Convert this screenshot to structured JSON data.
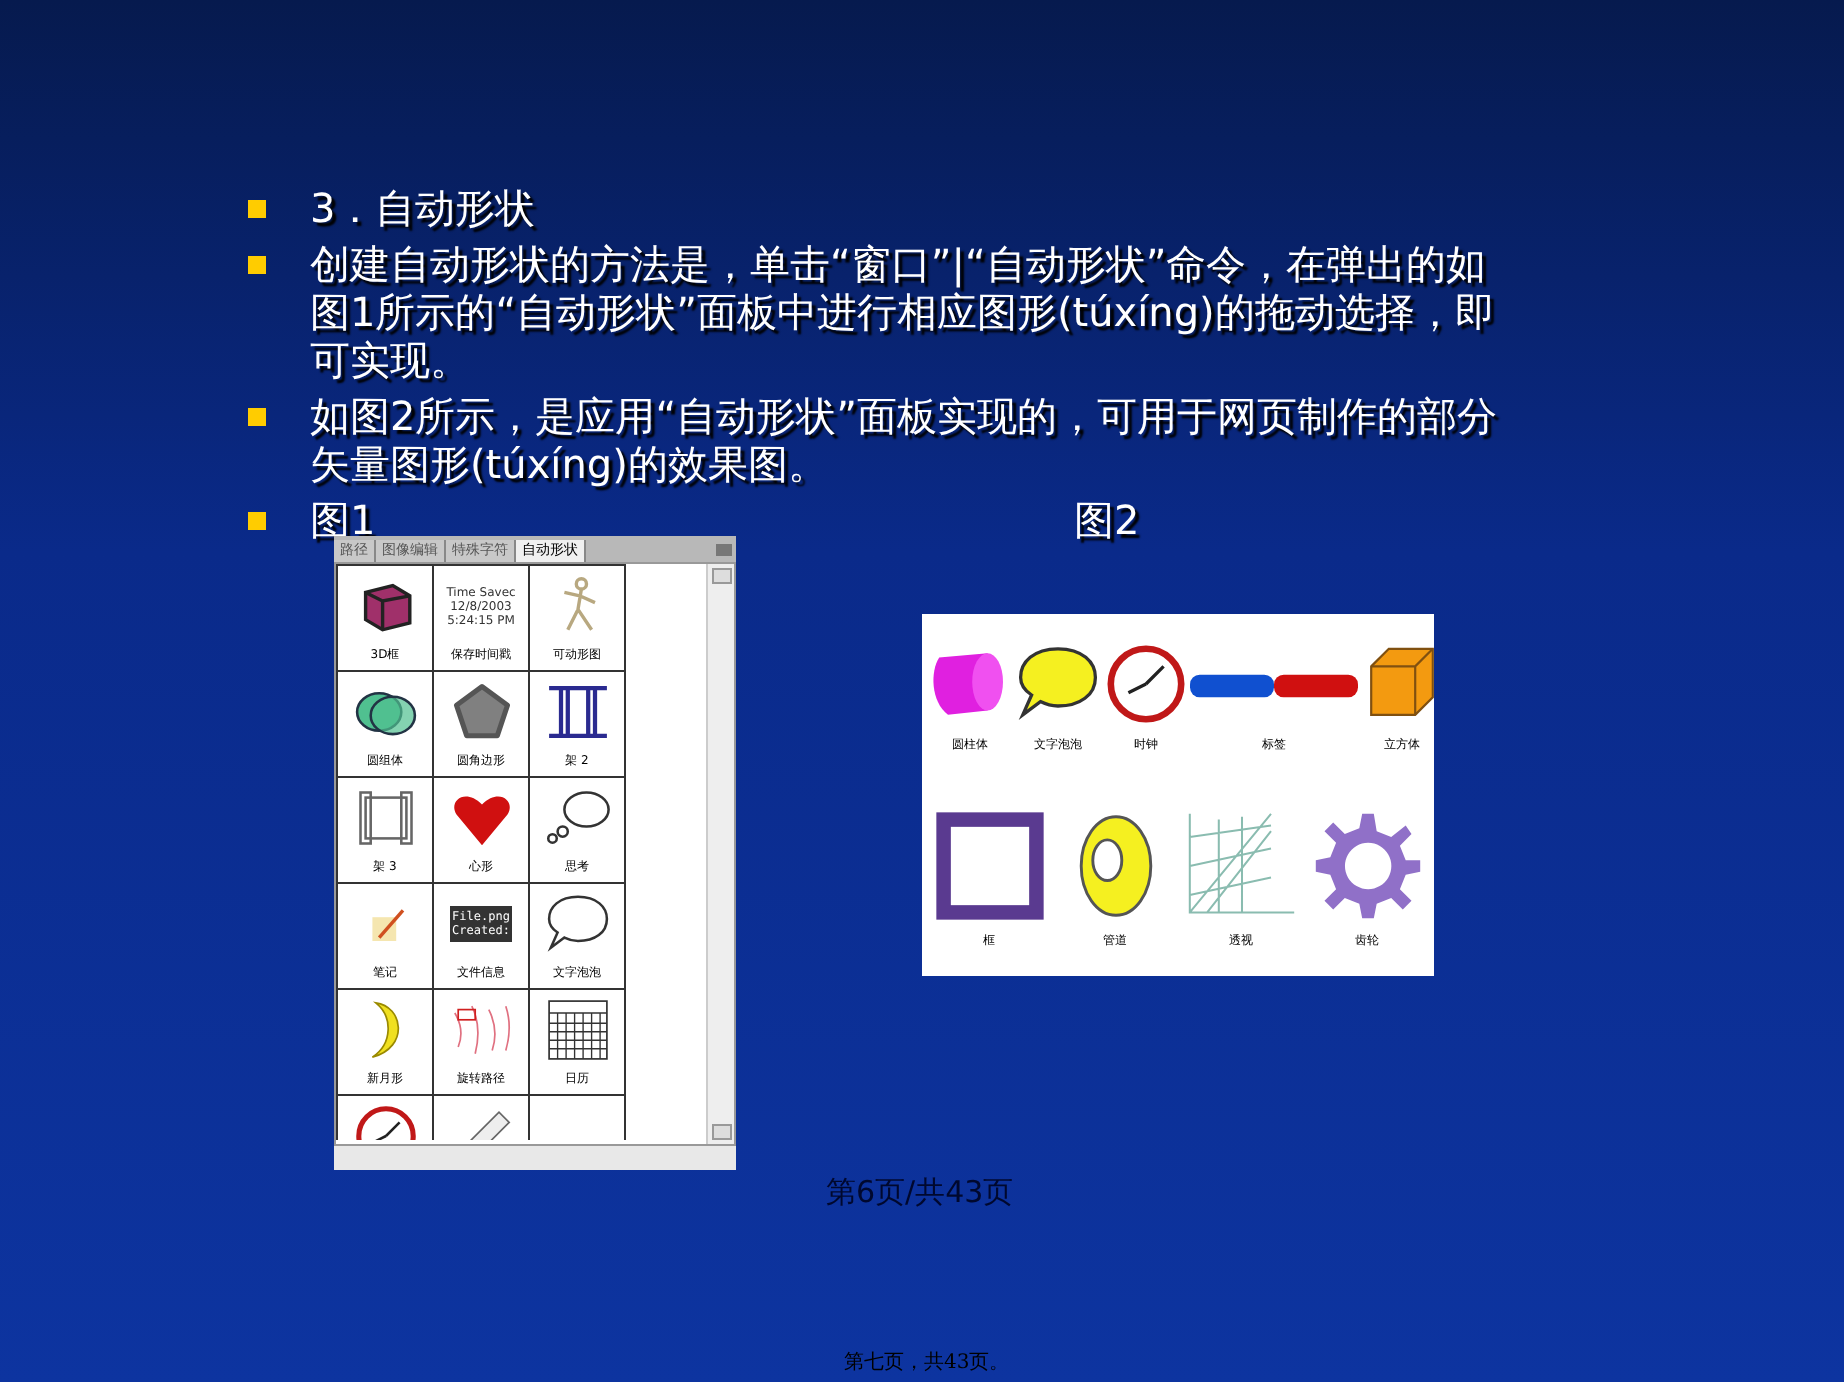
{
  "bullets": [
    "3．自动形状",
    "创建自动形状的方法是，单击“窗口”|“自动形状”命令，在弹出的如图1所示的“自动形状”面板中进行相应图形(túxíng)的拖动选择，即可实现。",
    "如图2所示，是应用“自动形状”面板实现的，可用于网页制作的部分矢量图形(túxíng)的效果图。"
  ],
  "captions": [
    "图1",
    "图2"
  ],
  "panel": {
    "tabs": [
      {
        "label": "路径",
        "selected": false
      },
      {
        "label": "图像编辑",
        "selected": false
      },
      {
        "label": "特殊字符",
        "selected": false
      },
      {
        "label": "自动形状",
        "selected": true
      }
    ],
    "timestamp_lines": [
      "Time Savec",
      "12/8/2003",
      "5:24:15 PM"
    ],
    "file_info_lines": [
      "File.png",
      "Created:"
    ],
    "cells": [
      {
        "kind": "box3d",
        "label": "3D框"
      },
      {
        "kind": "timestamp",
        "label": "保存时间戳"
      },
      {
        "kind": "figure",
        "label": "可动形图"
      },
      {
        "kind": "circles",
        "label": "圆组体"
      },
      {
        "kind": "pentagon",
        "label": "圆角边形"
      },
      {
        "kind": "frame2",
        "label": "架 2"
      },
      {
        "kind": "frame3",
        "label": "架 3"
      },
      {
        "kind": "heart",
        "label": "心形"
      },
      {
        "kind": "thought",
        "label": "思考"
      },
      {
        "kind": "note",
        "label": "笔记"
      },
      {
        "kind": "fileinfo",
        "label": "文件信息"
      },
      {
        "kind": "speech",
        "label": "文字泡泡"
      },
      {
        "kind": "moon",
        "label": "新月形"
      },
      {
        "kind": "path",
        "label": "旋转路径"
      },
      {
        "kind": "calendar",
        "label": "日历"
      },
      {
        "kind": "clock"
      },
      {
        "kind": "ruler"
      },
      {
        "kind": "tab"
      }
    ]
  },
  "figure2": {
    "items": [
      {
        "kind": "cylinder",
        "label": "圆柱体"
      },
      {
        "kind": "bubble",
        "label": "文字泡泡"
      },
      {
        "kind": "clock",
        "label": "时钟"
      },
      {
        "kind": "tabs",
        "label": "标签"
      },
      {
        "kind": "cube",
        "label": "立方体"
      },
      {
        "kind": "frame",
        "label": "框"
      },
      {
        "kind": "pipe",
        "label": "管道"
      },
      {
        "kind": "perspective",
        "label": "透视"
      },
      {
        "kind": "gear",
        "label": "齿轮"
      }
    ]
  },
  "footer": {
    "page": "第6页/共43页",
    "note": "第七页，共43页。"
  }
}
